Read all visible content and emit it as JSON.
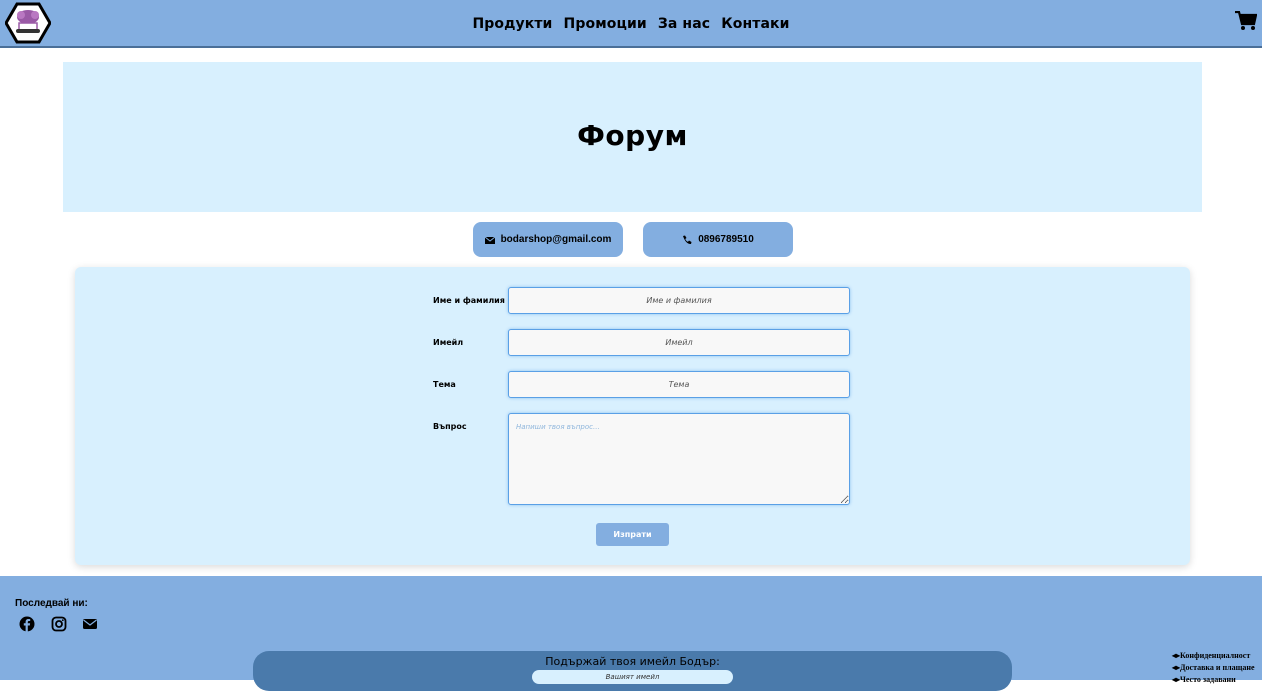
{
  "header": {
    "logo_icon": "bodar-logo-icon",
    "nav": [
      {
        "label": "Продукти"
      },
      {
        "label": "Промоции"
      },
      {
        "label": "За нас"
      },
      {
        "label": "Контаки"
      }
    ],
    "cart_icon": "shopping-cart-icon",
    "background": "#83aee0"
  },
  "hero": {
    "title": "Форум",
    "background": "#d8f0fe"
  },
  "contacts": {
    "email": "bodarshop@gmail.com",
    "phone": "0896789510"
  },
  "form": {
    "fields": [
      {
        "label": "Име и фамилия",
        "placeholder": "Име и фамилия"
      },
      {
        "label": "Имейл",
        "placeholder": "Имейл"
      },
      {
        "label": "Тема",
        "placeholder": "Тема"
      },
      {
        "label": "Въпрос",
        "placeholder": "Напиши твоя въпрос..."
      }
    ],
    "submit_label": "Изпрати"
  },
  "footer": {
    "follow_label": "Последвай ни:",
    "social_icons": [
      "facebook-icon",
      "instagram-icon",
      "envelope-icon"
    ],
    "newsletter_title": "Подържай твоя имейл Бодър:",
    "newsletter_placeholder": "Вашият имейл",
    "links": [
      {
        "label": "Конфиденциалност"
      },
      {
        "label": "Доставка и плащане"
      },
      {
        "label": "Често задавани"
      }
    ],
    "newsletter_bg": "#4a7aab"
  }
}
